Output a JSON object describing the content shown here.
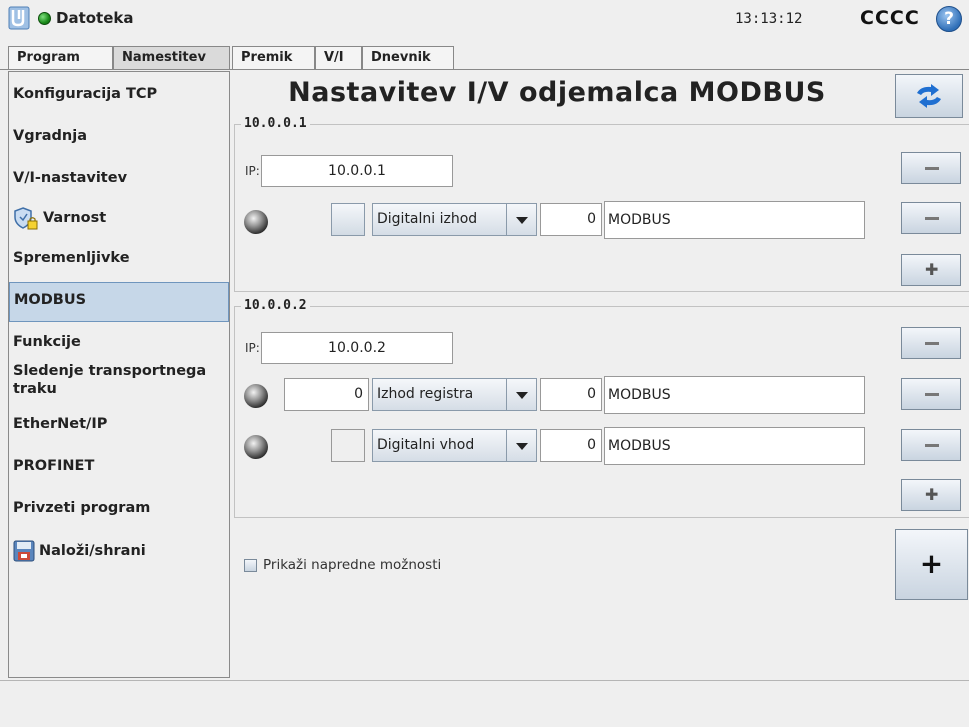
{
  "topbar": {
    "file_menu": "Datoteka",
    "clock": "13:13:12",
    "robot_name": "CCCC",
    "help_label": "?"
  },
  "tabs": [
    {
      "label": "Program"
    },
    {
      "label": "Namestitev"
    },
    {
      "label": "Premik"
    },
    {
      "label": "V/I"
    },
    {
      "label": "Dnevnik"
    }
  ],
  "sidebar": {
    "items": [
      {
        "label": "Konfiguracija TCP"
      },
      {
        "label": "Vgradnja"
      },
      {
        "label": "V/I-nastavitev"
      },
      {
        "label": "Varnost"
      },
      {
        "label": "Spremenljivke"
      },
      {
        "label": "MODBUS"
      },
      {
        "label": "Funkcije"
      },
      {
        "label": "Sledenje transportnega traku"
      },
      {
        "label": "EtherNet/IP"
      },
      {
        "label": "PROFINET"
      },
      {
        "label": "Privzeti program"
      },
      {
        "label": "Naloži/shrani"
      }
    ]
  },
  "main": {
    "title": "Nastavitev I/V odjemalca MODBUS",
    "ip_label": "IP:",
    "groups": [
      {
        "name": "10.0.0.1",
        "ip": "10.0.0.1",
        "signals": [
          {
            "value": "",
            "type": "Digitalni izhod",
            "address": "0",
            "signal_name": "MODBUS"
          }
        ]
      },
      {
        "name": "10.0.0.2",
        "ip": "10.0.0.2",
        "signals": [
          {
            "value": "0",
            "type": "Izhod registra",
            "address": "0",
            "signal_name": "MODBUS"
          },
          {
            "value": "",
            "type": "Digitalni vhod",
            "address": "0",
            "signal_name": "MODBUS"
          }
        ]
      }
    ],
    "advanced_label": "Prikaži napredne možnosti",
    "add_unit_label": "+"
  }
}
